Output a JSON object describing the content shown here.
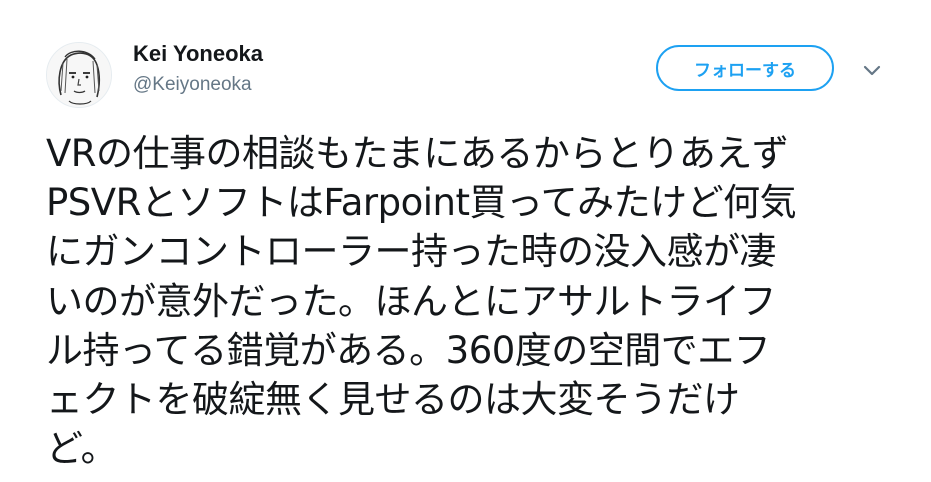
{
  "user": {
    "display_name": "Kei Yoneoka",
    "handle": "@Keiyoneoka"
  },
  "follow_button": {
    "label": "フォローする"
  },
  "tweet": {
    "lines": [
      "VRの仕事の相談もたまにあるからとりあえず",
      "PSVRとソフトはFarpoint買ってみたけど何気",
      "にガンコントローラー持った時の没入感が凄",
      "いのが意外だった。ほんとにアサルトライフ",
      "ル持ってる錯覚がある。360度の空間でエフ",
      "ェクトを破綻無く見せるのは大変そうだけ",
      "ど。"
    ]
  },
  "colors": {
    "accent": "#1da1f2",
    "text": "#14171a",
    "secondary_text": "#657786"
  },
  "icons": {
    "avatar": "sketch-face-avatar",
    "caret": "chevron-down-icon"
  }
}
